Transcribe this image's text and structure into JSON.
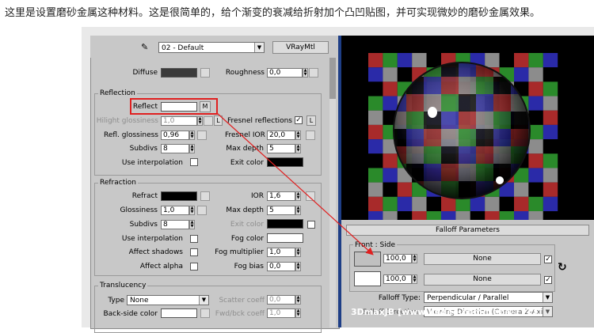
{
  "caption": "这里是设置磨砂金属这种材料。这是很简单的，给个渐变的衰减给折射加个凸凹贴图，并可实现微妙的磨砂金属效果。",
  "toolbar": {
    "material_name": "02 - Default",
    "material_type": "VRayMtl"
  },
  "diffuse": {
    "diffuse_label": "Diffuse",
    "roughness_label": "Roughness",
    "roughness_value": "0,0"
  },
  "reflection": {
    "title": "Reflection",
    "reflect_label": "Reflect",
    "reflect_map_button": "M",
    "hilight_label": "Hilight glossiness",
    "hilight_value": "1,0",
    "hilight_lock": "L",
    "refl_gloss_label": "Refl. glossiness",
    "refl_gloss_value": "0,96",
    "subdivs_label": "Subdivs",
    "subdivs_value": "8",
    "use_interp_label": "Use interpolation",
    "fresnel_label": "Fresnel reflections",
    "fresnel_lock": "L",
    "fresnel_ior_label": "Fresnel IOR",
    "fresnel_ior_value": "20,0",
    "max_depth_label": "Max depth",
    "max_depth_value": "5",
    "exit_color_label": "Exit color"
  },
  "refraction": {
    "title": "Refraction",
    "refract_label": "Refract",
    "ior_label": "IOR",
    "ior_value": "1,6",
    "glossiness_label": "Glossiness",
    "glossiness_value": "1,0",
    "max_depth_label": "Max depth",
    "max_depth_value": "5",
    "subdivs_label": "Subdivs",
    "subdivs_value": "8",
    "exit_color_label": "Exit color",
    "use_interp_label": "Use interpolation",
    "fog_color_label": "Fog color",
    "affect_shadows_label": "Affect shadows",
    "fog_mult_label": "Fog multiplier",
    "fog_mult_value": "1,0",
    "affect_alpha_label": "Affect alpha",
    "fog_bias_label": "Fog bias",
    "fog_bias_value": "0,0"
  },
  "translucency": {
    "title": "Translucency",
    "type_label": "Type",
    "type_value": "None",
    "scatter_label": "Scatter coeff",
    "scatter_value": "0,0",
    "back_side_label": "Back-side color",
    "fwd_bck_label": "Fwd/bck coeff",
    "fwd_bck_value": "1,0"
  },
  "falloff": {
    "title": "Falloff Parameters",
    "front_side_label": "Front : Side",
    "row1_value": "100,0",
    "row1_map": "None",
    "row2_value": "100,0",
    "row2_map": "None",
    "falloff_type_label": "Falloff Type:",
    "falloff_type_value": "Perpendicular / Parallel",
    "falloff_direction_label": "Falloff Direction:",
    "falloff_direction_value": "Viewing Direction (Camera Z-Axis)"
  },
  "watermark": {
    "text": "3DmaxJB [www.lingee.com/tieba/1771]"
  },
  "colors": {
    "accent_red": "#e02020",
    "diffuse_swatch": "#3a3a3a",
    "reflect_swatch": "#ffffff",
    "exit_color": "#000000",
    "refract_swatch": "#000000",
    "fog_color": "#ffffff",
    "falloff_front": "#c0c0c0",
    "falloff_side": "#ffffff",
    "panel_bg": "#c8c8c8",
    "divider": "#1e3e86",
    "checker_red": "#a82a2a",
    "checker_green": "#2a8a2a",
    "checker_blue": "#2a2aa8",
    "checker_gray": "#8c8c8c",
    "checker_black": "#000000"
  }
}
